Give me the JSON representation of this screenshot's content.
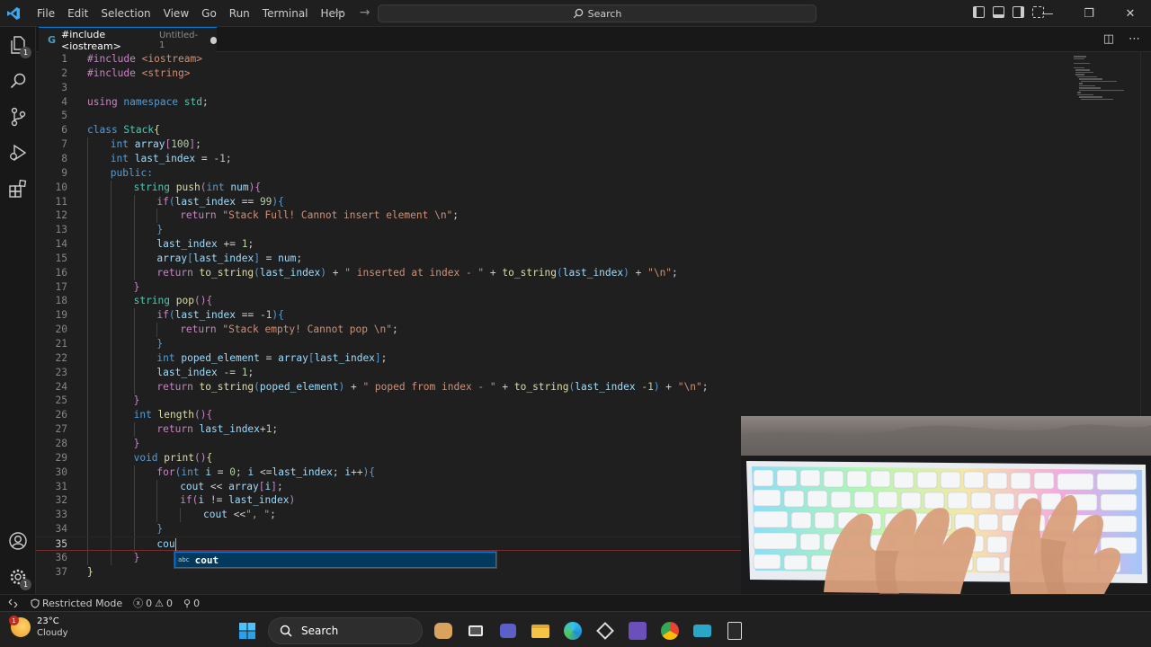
{
  "menu": [
    "File",
    "Edit",
    "Selection",
    "View",
    "Go",
    "Run",
    "Terminal",
    "Help"
  ],
  "search": {
    "label": "Search"
  },
  "tab": {
    "icon_text": "G",
    "title": "#include <iostream>",
    "subtitle": "Untitled-1"
  },
  "activity_badges": {
    "explorer": "1",
    "settings": "1"
  },
  "code_lines": [
    {
      "n": "1",
      "indent": 0,
      "parts": [
        [
          "c",
          "#include "
        ],
        [
          "s",
          "<iostream>"
        ]
      ]
    },
    {
      "n": "2",
      "indent": 0,
      "parts": [
        [
          "c",
          "#include "
        ],
        [
          "s",
          "<string>"
        ]
      ]
    },
    {
      "n": "3",
      "indent": 0,
      "parts": []
    },
    {
      "n": "4",
      "indent": 0,
      "parts": [
        [
          "c",
          "using "
        ],
        [
          "k",
          "namespace "
        ],
        [
          "t",
          "std"
        ],
        [
          "p",
          ";"
        ]
      ]
    },
    {
      "n": "5",
      "indent": 0,
      "parts": []
    },
    {
      "n": "6",
      "indent": 0,
      "parts": [
        [
          "k",
          "class "
        ],
        [
          "t",
          "Stack"
        ],
        [
          "f",
          "{"
        ]
      ]
    },
    {
      "n": "7",
      "indent": 1,
      "parts": [
        [
          "k",
          "int "
        ],
        [
          "v",
          "array"
        ],
        [
          "c",
          "["
        ],
        [
          "n",
          "100"
        ],
        [
          "c",
          "]"
        ],
        [
          "p",
          ";"
        ]
      ]
    },
    {
      "n": "8",
      "indent": 1,
      "parts": [
        [
          "k",
          "int "
        ],
        [
          "v",
          "last_index"
        ],
        [
          "p",
          " = "
        ],
        [
          "n",
          "-1"
        ],
        [
          "p",
          ";"
        ]
      ]
    },
    {
      "n": "9",
      "indent": 1,
      "parts": [
        [
          "k",
          "public:"
        ]
      ]
    },
    {
      "n": "10",
      "indent": 2,
      "parts": [
        [
          "t",
          "string "
        ],
        [
          "f",
          "push"
        ],
        [
          "c",
          "("
        ],
        [
          "k",
          "int "
        ],
        [
          "v",
          "num"
        ],
        [
          "c",
          "){"
        ]
      ]
    },
    {
      "n": "11",
      "indent": 3,
      "parts": [
        [
          "c",
          "if"
        ],
        [
          "k",
          "("
        ],
        [
          "v",
          "last_index"
        ],
        [
          "p",
          " == "
        ],
        [
          "n",
          "99"
        ],
        [
          "k",
          "){"
        ]
      ]
    },
    {
      "n": "12",
      "indent": 4,
      "parts": [
        [
          "c",
          "return "
        ],
        [
          "s",
          "\"Stack Full! Cannot insert element \\n\""
        ],
        [
          "p",
          ";"
        ]
      ]
    },
    {
      "n": "13",
      "indent": 3,
      "parts": [
        [
          "k",
          "}"
        ]
      ]
    },
    {
      "n": "14",
      "indent": 3,
      "parts": [
        [
          "v",
          "last_index"
        ],
        [
          "p",
          " += "
        ],
        [
          "n",
          "1"
        ],
        [
          "p",
          ";"
        ]
      ]
    },
    {
      "n": "15",
      "indent": 3,
      "parts": [
        [
          "v",
          "array"
        ],
        [
          "k",
          "["
        ],
        [
          "v",
          "last_index"
        ],
        [
          "k",
          "]"
        ],
        [
          "p",
          " = "
        ],
        [
          "v",
          "num"
        ],
        [
          "p",
          ";"
        ]
      ]
    },
    {
      "n": "16",
      "indent": 3,
      "parts": [
        [
          "c",
          "return "
        ],
        [
          "f",
          "to_string"
        ],
        [
          "k",
          "("
        ],
        [
          "v",
          "last_index"
        ],
        [
          "k",
          ")"
        ],
        [
          "p",
          " + "
        ],
        [
          "s",
          "\" inserted at index - \""
        ],
        [
          "p",
          " + "
        ],
        [
          "f",
          "to_string"
        ],
        [
          "k",
          "("
        ],
        [
          "v",
          "last_index"
        ],
        [
          "k",
          ")"
        ],
        [
          "p",
          " + "
        ],
        [
          "s",
          "\"\\n\""
        ],
        [
          "p",
          ";"
        ]
      ]
    },
    {
      "n": "17",
      "indent": 2,
      "parts": [
        [
          "c",
          "}"
        ]
      ]
    },
    {
      "n": "18",
      "indent": 2,
      "parts": [
        [
          "t",
          "string "
        ],
        [
          "f",
          "pop"
        ],
        [
          "c",
          "(){"
        ]
      ]
    },
    {
      "n": "19",
      "indent": 3,
      "parts": [
        [
          "c",
          "if"
        ],
        [
          "k",
          "("
        ],
        [
          "v",
          "last_index"
        ],
        [
          "p",
          " == "
        ],
        [
          "n",
          "-1"
        ],
        [
          "k",
          "){"
        ]
      ]
    },
    {
      "n": "20",
      "indent": 4,
      "parts": [
        [
          "c",
          "return "
        ],
        [
          "s",
          "\"Stack empty! Cannot pop \\n\""
        ],
        [
          "p",
          ";"
        ]
      ]
    },
    {
      "n": "21",
      "indent": 3,
      "parts": [
        [
          "k",
          "}"
        ]
      ]
    },
    {
      "n": "22",
      "indent": 3,
      "parts": [
        [
          "k",
          "int "
        ],
        [
          "v",
          "poped_element"
        ],
        [
          "p",
          " = "
        ],
        [
          "v",
          "array"
        ],
        [
          "k",
          "["
        ],
        [
          "v",
          "last_index"
        ],
        [
          "k",
          "]"
        ],
        [
          "p",
          ";"
        ]
      ]
    },
    {
      "n": "23",
      "indent": 3,
      "parts": [
        [
          "v",
          "last_index"
        ],
        [
          "p",
          " -= "
        ],
        [
          "n",
          "1"
        ],
        [
          "p",
          ";"
        ]
      ]
    },
    {
      "n": "24",
      "indent": 3,
      "parts": [
        [
          "c",
          "return "
        ],
        [
          "f",
          "to_string"
        ],
        [
          "k",
          "("
        ],
        [
          "v",
          "poped_element"
        ],
        [
          "k",
          ")"
        ],
        [
          "p",
          " + "
        ],
        [
          "s",
          "\" poped from index - \""
        ],
        [
          "p",
          " + "
        ],
        [
          "f",
          "to_string"
        ],
        [
          "k",
          "("
        ],
        [
          "v",
          "last_index "
        ],
        [
          "n",
          "-1"
        ],
        [
          "k",
          ")"
        ],
        [
          "p",
          " + "
        ],
        [
          "s",
          "\"\\n\""
        ],
        [
          "p",
          ";"
        ]
      ]
    },
    {
      "n": "25",
      "indent": 2,
      "parts": [
        [
          "c",
          "}"
        ]
      ]
    },
    {
      "n": "26",
      "indent": 2,
      "parts": [
        [
          "k",
          "int "
        ],
        [
          "f",
          "length"
        ],
        [
          "c",
          "(){"
        ]
      ]
    },
    {
      "n": "27",
      "indent": 3,
      "parts": [
        [
          "c",
          "return "
        ],
        [
          "v",
          "last_index"
        ],
        [
          "p",
          "+"
        ],
        [
          "n",
          "1"
        ],
        [
          "p",
          ";"
        ]
      ]
    },
    {
      "n": "28",
      "indent": 2,
      "parts": [
        [
          "c",
          "}"
        ]
      ]
    },
    {
      "n": "29",
      "indent": 2,
      "parts": [
        [
          "k",
          "void "
        ],
        [
          "f",
          "print"
        ],
        [
          "c",
          "()"
        ],
        [
          "f",
          "{"
        ]
      ]
    },
    {
      "n": "30",
      "indent": 3,
      "parts": [
        [
          "c",
          "for"
        ],
        [
          "k",
          "("
        ],
        [
          "k",
          "int "
        ],
        [
          "v",
          "i"
        ],
        [
          "p",
          " = "
        ],
        [
          "n",
          "0"
        ],
        [
          "p",
          "; "
        ],
        [
          "v",
          "i"
        ],
        [
          "p",
          " <="
        ],
        [
          "v",
          "last_index"
        ],
        [
          "p",
          "; "
        ],
        [
          "v",
          "i"
        ],
        [
          "p",
          "++"
        ],
        [
          "k",
          "){"
        ]
      ]
    },
    {
      "n": "31",
      "indent": 4,
      "parts": [
        [
          "v",
          "cout"
        ],
        [
          "p",
          " << "
        ],
        [
          "v",
          "array"
        ],
        [
          "c",
          "["
        ],
        [
          "v",
          "i"
        ],
        [
          "c",
          "]"
        ],
        [
          "p",
          ";"
        ]
      ]
    },
    {
      "n": "32",
      "indent": 4,
      "parts": [
        [
          "c",
          "if"
        ],
        [
          "c",
          "("
        ],
        [
          "v",
          "i"
        ],
        [
          "p",
          " != "
        ],
        [
          "v",
          "last_index"
        ],
        [
          "c",
          ")"
        ]
      ]
    },
    {
      "n": "33",
      "indent": 5,
      "parts": [
        [
          "v",
          "cout"
        ],
        [
          "p",
          " <<"
        ],
        [
          "s",
          "\", \""
        ],
        [
          "p",
          ";"
        ]
      ]
    },
    {
      "n": "34",
      "indent": 3,
      "parts": [
        [
          "k",
          "}"
        ]
      ]
    },
    {
      "n": "35",
      "indent": 3,
      "parts": [
        [
          "v",
          "cou"
        ]
      ]
    },
    {
      "n": "36",
      "indent": 2,
      "parts": [
        [
          "c",
          "}"
        ]
      ]
    },
    {
      "n": "37",
      "indent": 0,
      "parts": [
        [
          "f",
          "}"
        ]
      ]
    }
  ],
  "suggestion": {
    "kind": "abc",
    "text": "cout"
  },
  "status": {
    "mode": "Restricted Mode",
    "errors": "0",
    "warnings": "0",
    "ports": "0"
  },
  "weather": {
    "temp": "23°C",
    "condition": "Cloudy",
    "badge": "1"
  },
  "taskbar": {
    "search": "Search"
  },
  "colors": {
    "accent": "#0078d4",
    "keyword": "#569cd6",
    "control": "#c586c0",
    "string": "#ce9178",
    "type": "#4ec9b0",
    "function": "#dcdcaa",
    "variable": "#9cdcfe",
    "number": "#b5cea8"
  }
}
